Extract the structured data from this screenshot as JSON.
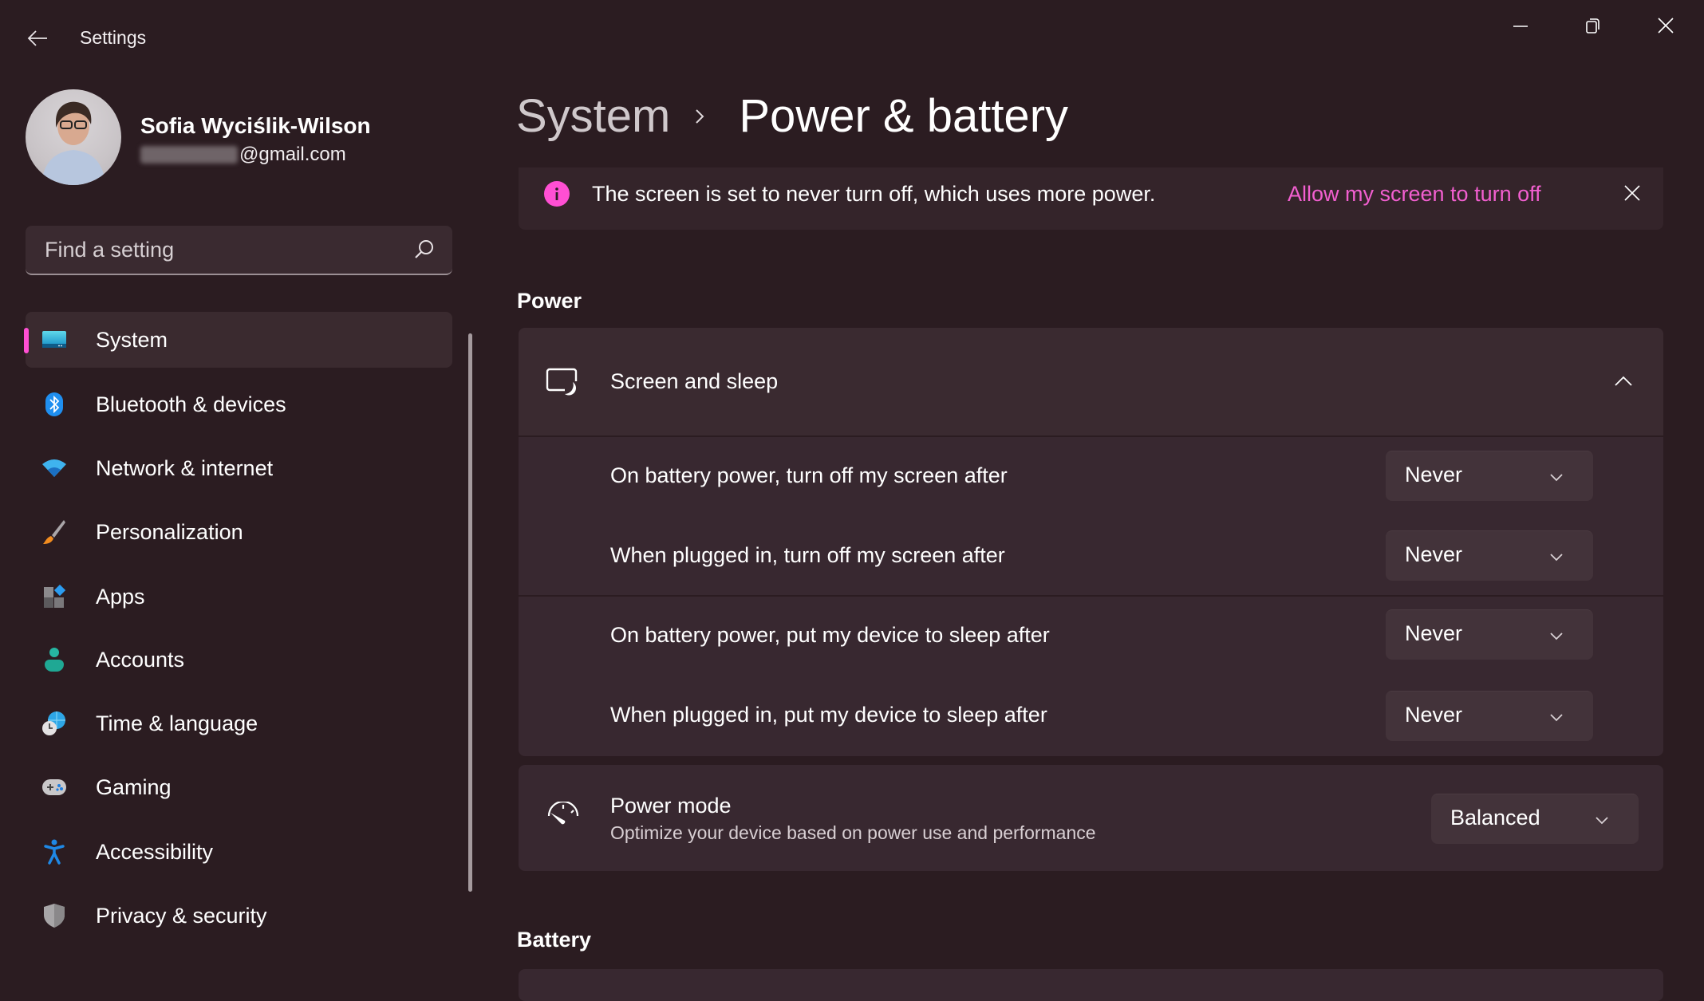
{
  "titlebar": {
    "app_title": "Settings",
    "back_icon": "arrow-left-icon",
    "minimize_icon": "minimize-icon",
    "restore_icon": "restore-icon",
    "close_icon": "close-icon"
  },
  "profile": {
    "name": "Sofia Wyciślik-Wilson",
    "email_visible_suffix": "@gmail.com",
    "email_redacted": true
  },
  "search": {
    "placeholder": "Find a setting",
    "value": "",
    "icon": "search-icon"
  },
  "sidebar": {
    "selected_index": 0,
    "items": [
      {
        "label": "System",
        "icon": "monitor-icon"
      },
      {
        "label": "Bluetooth & devices",
        "icon": "bluetooth-icon"
      },
      {
        "label": "Network & internet",
        "icon": "wifi-icon"
      },
      {
        "label": "Personalization",
        "icon": "paintbrush-icon"
      },
      {
        "label": "Apps",
        "icon": "apps-icon"
      },
      {
        "label": "Accounts",
        "icon": "person-icon"
      },
      {
        "label": "Time & language",
        "icon": "globe-clock-icon"
      },
      {
        "label": "Gaming",
        "icon": "gamepad-icon"
      },
      {
        "label": "Accessibility",
        "icon": "accessibility-icon"
      },
      {
        "label": "Privacy & security",
        "icon": "shield-icon"
      }
    ]
  },
  "breadcrumb": {
    "parent": "System",
    "current": "Power & battery"
  },
  "banner": {
    "icon": "info-icon",
    "message": "The screen is set to never turn off, which uses more power.",
    "link": "Allow my screen to turn off"
  },
  "sections": {
    "power": "Power",
    "battery": "Battery"
  },
  "screen_and_sleep": {
    "title": "Screen and sleep",
    "icon": "screen-sleep-icon",
    "expanded": true,
    "settings": [
      {
        "label": "On battery power, turn off my screen after",
        "value": "Never"
      },
      {
        "label": "When plugged in, turn off my screen after",
        "value": "Never"
      },
      {
        "label": "On battery power, put my device to sleep after",
        "value": "Never"
      },
      {
        "label": "When plugged in, put my device to sleep after",
        "value": "Never"
      }
    ]
  },
  "power_mode": {
    "title": "Power mode",
    "subtitle": "Optimize your device based on power use and performance",
    "icon": "speedometer-icon",
    "value": "Balanced"
  },
  "colors": {
    "accent": "#ff4fd3",
    "link": "#f25fd0",
    "background": "#2b1c21",
    "card": "#382830",
    "dropdown": "#43333a"
  }
}
